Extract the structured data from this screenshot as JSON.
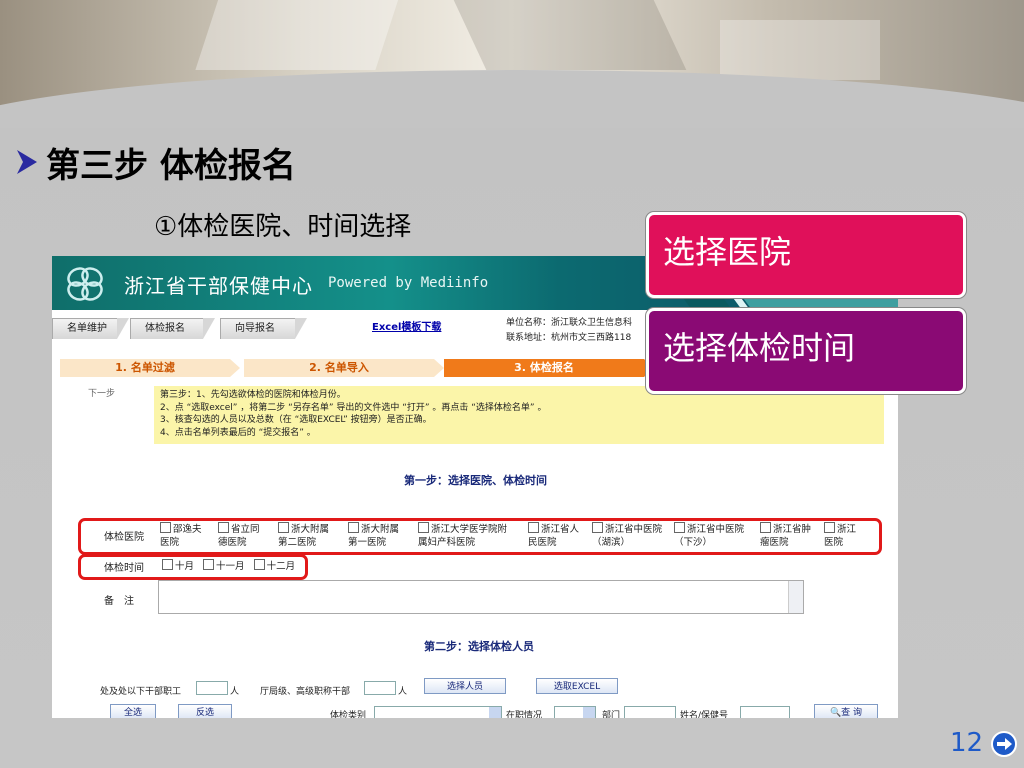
{
  "slide": {
    "title": "第三步 体检报名",
    "subtitle": "①体检医院、时间选择",
    "page_number": "12"
  },
  "callouts": {
    "hospital": "选择医院",
    "time": "选择体检时间"
  },
  "app": {
    "name": "浙江省干部保健中心",
    "powered_by": "Powered by Mediinfo"
  },
  "tabs": [
    {
      "label": "名单维护"
    },
    {
      "label": "体检报名"
    },
    {
      "label": "向导报名"
    }
  ],
  "excel_link": "Excel模板下载",
  "unit_info": {
    "name": "单位名称：浙江联众卫生信息科",
    "address": "联系地址：杭州市文三西路118"
  },
  "steps": [
    {
      "label": "1. 名单过滤"
    },
    {
      "label": "2. 名单导入"
    },
    {
      "label": "3. 体检报名"
    }
  ],
  "next_step": "下一步",
  "instructions": [
    "第三步：1、先勾选欲体检的医院和体检月份。",
    "2、点 “选取excel” ，将第二步 “另存名单” 导出的文件选中 “打开” 。再点击 “选择体检名单” 。",
    "3、核查勾选的人员以及总数（在 “选取EXCEL” 按钮旁）是否正确。",
    "4、点击名单列表最后的 “提交报名” 。"
  ],
  "step1_title": "第一步：选择医院、体检时间",
  "hospital_label": "体检医院",
  "hospitals": [
    {
      "l1": "邵逸夫",
      "l2": "医院"
    },
    {
      "l1": "省立同",
      "l2": "德医院"
    },
    {
      "l1": "浙大附属",
      "l2": "第二医院"
    },
    {
      "l1": "浙大附属",
      "l2": "第一医院"
    },
    {
      "l1": "浙江大学医学院附",
      "l2": "属妇产科医院"
    },
    {
      "l1": "浙江省人",
      "l2": "民医院"
    },
    {
      "l1": "浙江省中医院",
      "l2": "（湖滨）"
    },
    {
      "l1": "浙江省中医院",
      "l2": "（下沙）"
    },
    {
      "l1": "浙江省肿",
      "l2": "瘤医院"
    },
    {
      "l1": "浙江",
      "l2": "医院"
    }
  ],
  "time_label": "体检时间",
  "months": [
    "十月",
    "十一月",
    "十二月"
  ],
  "remarks_label": "备　注",
  "step2_title": "第二步：选择体检人员",
  "bottom": {
    "staff_label": "处及处以下干部职工",
    "unit_person": "人",
    "senior_label": "厅局级、高级职称干部",
    "select_people": "选择人员",
    "select_excel": "选取EXCEL",
    "select_all": "全选",
    "invert": "反选",
    "exam_type": "体检类别",
    "job_status": "在职情况",
    "dept": "部门",
    "name_id": "姓名/保健号",
    "query": "查 询"
  }
}
